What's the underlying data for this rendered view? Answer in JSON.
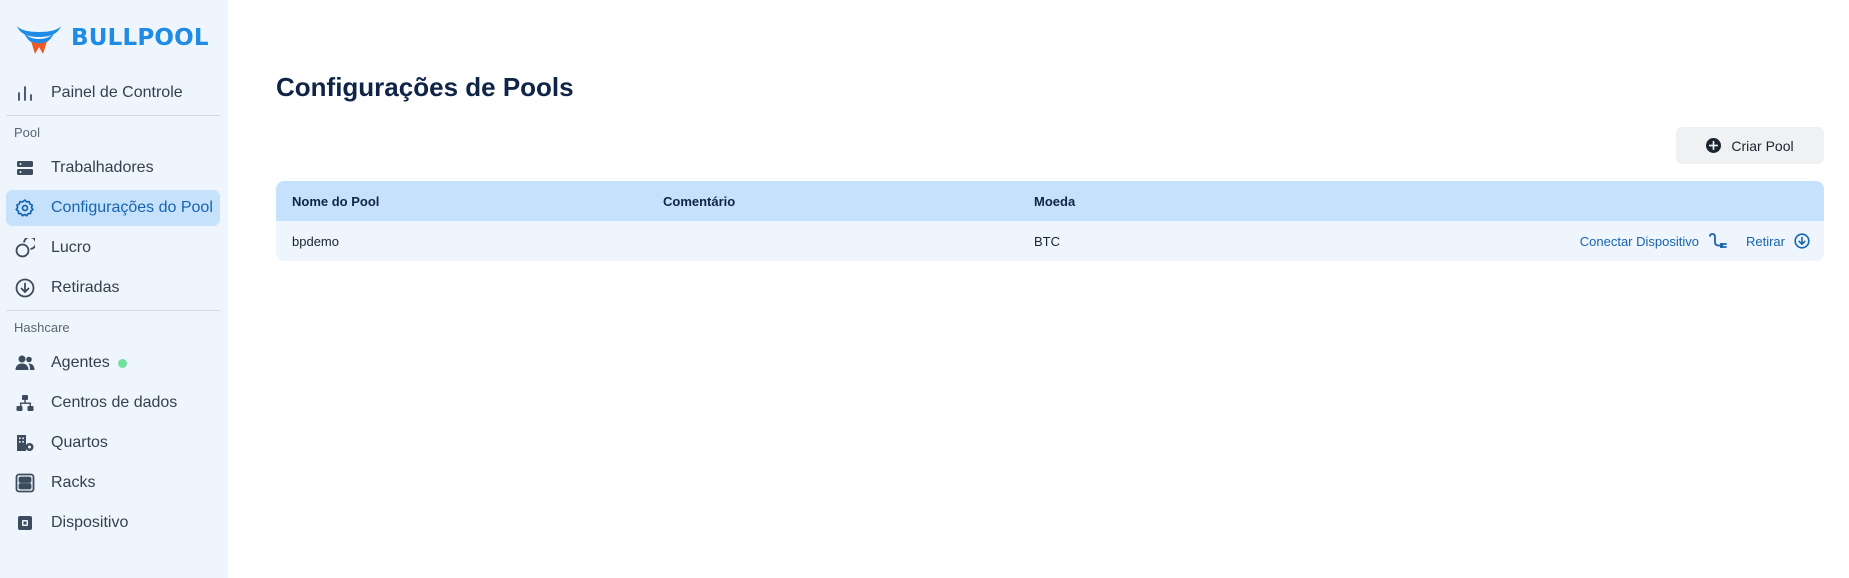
{
  "brand": {
    "name": "BULLPOOL",
    "accent": "#1e8be5",
    "logo_secondary": "#f05a22"
  },
  "sidebar": {
    "top_item": {
      "label": "Painel de Controle",
      "icon": "bar-chart-icon"
    },
    "sections": [
      {
        "label": "Pool",
        "items": [
          {
            "label": "Trabalhadores",
            "icon": "server-icon",
            "active": false
          },
          {
            "label": "Configurações do Pool",
            "icon": "gear-icon",
            "active": true
          },
          {
            "label": "Lucro",
            "icon": "coins-icon",
            "active": false
          },
          {
            "label": "Retiradas",
            "icon": "arrow-down-circle-icon",
            "active": false
          }
        ]
      },
      {
        "label": "Hashcare",
        "items": [
          {
            "label": "Agentes",
            "icon": "users-icon",
            "status": "online"
          },
          {
            "label": "Centros de dados",
            "icon": "sitemap-icon"
          },
          {
            "label": "Quartos",
            "icon": "building-gear-icon"
          },
          {
            "label": "Racks",
            "icon": "rack-icon"
          },
          {
            "label": "Dispositivo",
            "icon": "chip-icon"
          }
        ]
      }
    ]
  },
  "main": {
    "title": "Configurações de Pools",
    "create_button": {
      "label": "Criar Pool",
      "icon": "plus-circle-icon"
    },
    "table": {
      "columns": [
        "Nome do Pool",
        "Comentário",
        "Moeda"
      ],
      "rows": [
        {
          "name": "bpdemo",
          "comment": "",
          "currency": "BTC",
          "actions": [
            {
              "label": "Conectar Dispositivo",
              "icon": "plug-icon"
            },
            {
              "label": "Retirar",
              "icon": "arrow-down-circle-icon"
            }
          ]
        }
      ]
    }
  }
}
